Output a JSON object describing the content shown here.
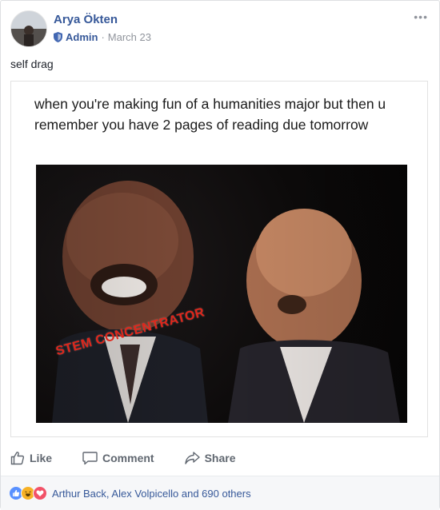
{
  "post": {
    "author": "Arya Ökten",
    "role": "Admin",
    "date": "March 23",
    "separator": "·",
    "more_label": "•••",
    "caption": "self drag"
  },
  "meme": {
    "top_text": "when you're making fun of a humanities major but then u remember you have 2 pages of reading due tomorrow",
    "overlay_text": "STEM CONCENTRATOR"
  },
  "actions": {
    "like": "Like",
    "comment": "Comment",
    "share": "Share"
  },
  "reactions": {
    "icons": [
      "like-icon",
      "haha-icon",
      "love-icon"
    ],
    "summary": "Arthur Back, Alex Volpicello and 690 others"
  },
  "colors": {
    "link_blue": "#365899",
    "muted_gray": "#90949c",
    "action_gray": "#606770",
    "overlay_red": "#e0261b"
  }
}
